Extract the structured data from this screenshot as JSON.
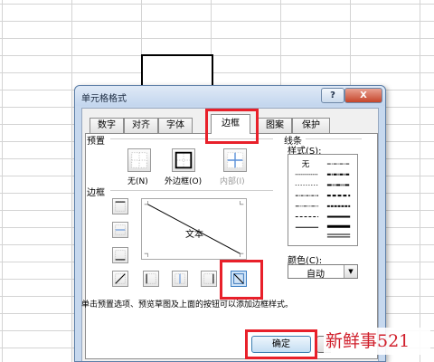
{
  "dialog": {
    "title": "单元格格式",
    "help_button": "?",
    "close_button": "X"
  },
  "tabs": [
    {
      "label": "数字"
    },
    {
      "label": "对齐"
    },
    {
      "label": "字体"
    },
    {
      "label": "边框",
      "active": true
    },
    {
      "label": "图案"
    },
    {
      "label": "保护"
    }
  ],
  "presets": {
    "label": "预置",
    "none": "无(N)",
    "outline": "外边框(O)",
    "inside": "内部(I)"
  },
  "border": {
    "label": "边框",
    "preview_text": "文本"
  },
  "line": {
    "label": "线条",
    "style_label": "样式(S):",
    "none_option": "无",
    "color_label": "颜色(C):",
    "color_value": "自动",
    "dropdown_arrow": "▼"
  },
  "hint": "单击预置选项、预览草图及上面的按钮可以添加边框样式。",
  "buttons": {
    "ok": "确定"
  },
  "watermark": "新鲜事521",
  "colors": {
    "highlight": "#e8202a",
    "watermark": "#d01f2b"
  }
}
